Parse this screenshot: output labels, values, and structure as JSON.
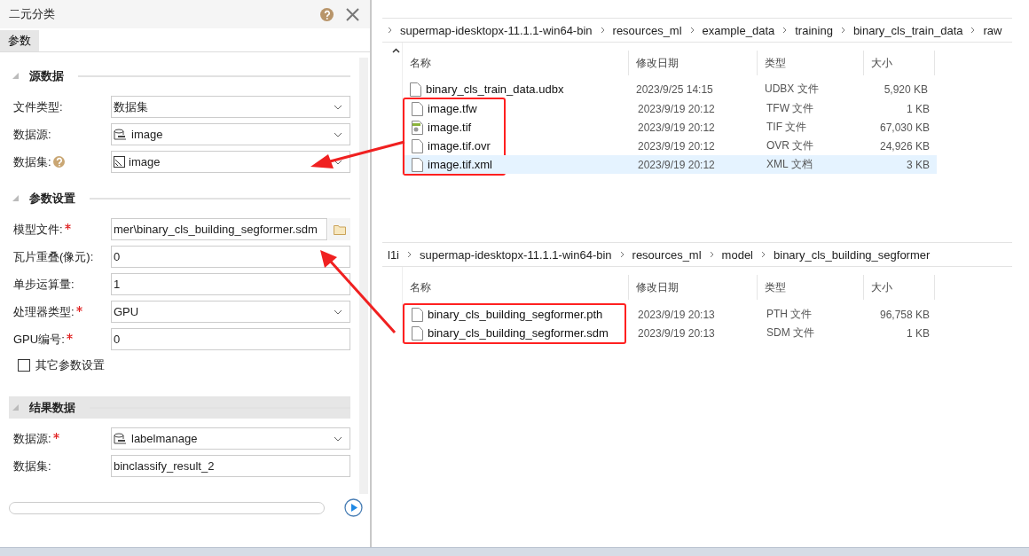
{
  "panel": {
    "title": "二元分类",
    "tabs": [
      {
        "label": "参数",
        "selected": true
      }
    ],
    "sections": [
      {
        "title": "源数据",
        "selected": false,
        "fields": [
          {
            "label": "文件类型:",
            "kind": "select",
            "value": "数据集",
            "required": false
          },
          {
            "label": "数据源:",
            "kind": "datasource",
            "value": "image",
            "required": false
          },
          {
            "label": "数据集:",
            "kind": "dataset",
            "value": "image",
            "help": true,
            "required": false
          }
        ]
      },
      {
        "title": "参数设置",
        "selected": false,
        "fields": [
          {
            "label": "模型文件:",
            "kind": "file",
            "value": "mer\\binary_cls_building_segformer.sdm",
            "required": true
          },
          {
            "label": "瓦片重叠(像元):",
            "kind": "text",
            "value": "0",
            "required": false
          },
          {
            "label": "单步运算量:",
            "kind": "text",
            "value": "1",
            "required": false
          },
          {
            "label": "处理器类型:",
            "kind": "select",
            "value": "GPU",
            "required": true
          },
          {
            "label": "GPU编号:",
            "kind": "text",
            "value": "0",
            "required": true
          }
        ],
        "checkbox": {
          "label": "其它参数设置",
          "checked": false
        }
      },
      {
        "title": "结果数据",
        "selected": true,
        "fields": [
          {
            "label": "数据源:",
            "kind": "datasource",
            "value": "labelmanage",
            "required": true
          },
          {
            "label": "数据集:",
            "kind": "text",
            "value": "binclassify_result_2",
            "required": false
          }
        ]
      }
    ],
    "progress": {
      "level": 0
    }
  },
  "explorers": [
    {
      "breadcrumb": [
        "supermap-idesktopx-11.1.1-win64-bin",
        "resources_ml",
        "example_data",
        "training",
        "binary_cls_train_data",
        "raw"
      ],
      "columns": [
        "名称",
        "修改日期",
        "类型",
        "大小"
      ],
      "rows": [
        {
          "name": "binary_cls_train_data.udbx",
          "date": "2023/9/25 14:15",
          "type": "UDBX 文件",
          "size": "5,920 KB",
          "kind": "file",
          "marked": false,
          "selected": false
        },
        {
          "name": "image.tfw",
          "date": "2023/9/19 20:12",
          "type": "TFW 文件",
          "size": "1 KB",
          "kind": "file",
          "marked": true,
          "selected": false
        },
        {
          "name": "image.tif",
          "date": "2023/9/19 20:12",
          "type": "TIF 文件",
          "size": "67,030 KB",
          "kind": "image",
          "marked": true,
          "selected": false
        },
        {
          "name": "image.tif.ovr",
          "date": "2023/9/19 20:12",
          "type": "OVR 文件",
          "size": "24,926 KB",
          "kind": "file",
          "marked": true,
          "selected": false
        },
        {
          "name": "image.tif.xml",
          "date": "2023/9/19 20:12",
          "type": "XML 文档",
          "size": "3 KB",
          "kind": "file",
          "marked": true,
          "selected": true
        }
      ]
    },
    {
      "breadcrumb": [
        "l1i",
        "supermap-idesktopx-11.1.1-win64-bin",
        "resources_ml",
        "model",
        "binary_cls_building_segformer"
      ],
      "columns": [
        "名称",
        "修改日期",
        "类型",
        "大小"
      ],
      "rows": [
        {
          "name": "binary_cls_building_segformer.pth",
          "date": "2023/9/19 20:13",
          "type": "PTH 文件",
          "size": "96,758 KB",
          "kind": "file",
          "marked": true,
          "selected": false
        },
        {
          "name": "binary_cls_building_segformer.sdm",
          "date": "2023/9/19 20:13",
          "type": "SDM 文件",
          "size": "1 KB",
          "kind": "file",
          "marked": true,
          "selected": false
        }
      ]
    }
  ]
}
